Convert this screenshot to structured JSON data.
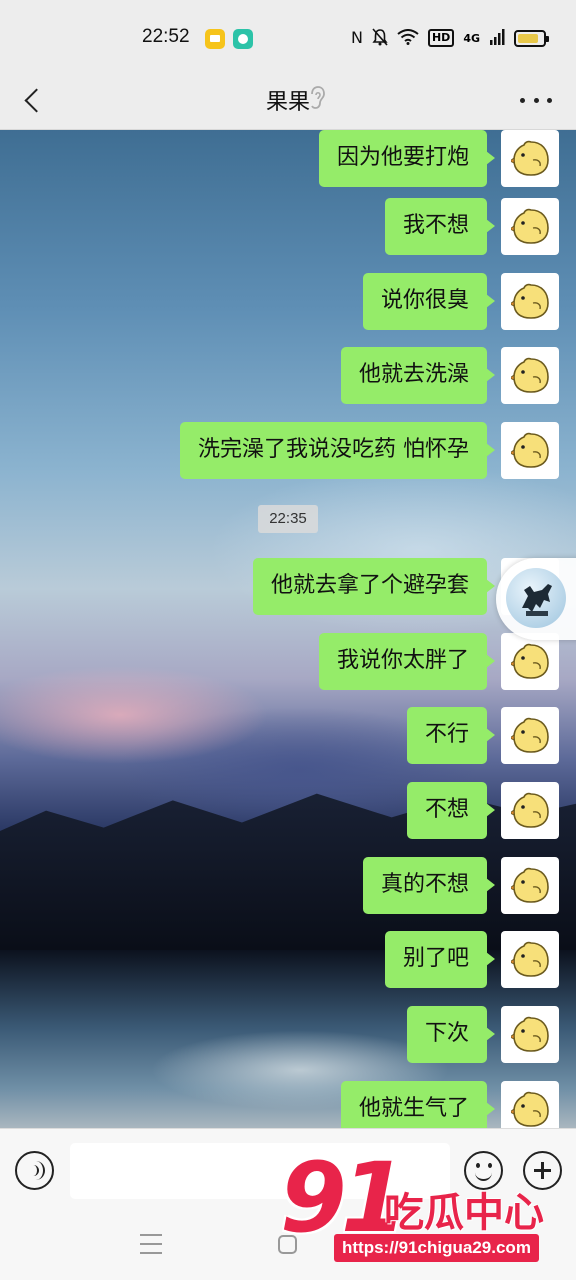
{
  "status_bar": {
    "time": "22:52",
    "network": "4G",
    "hd_label": "HD",
    "battery_level": 0.85
  },
  "header": {
    "title": "果果"
  },
  "messages": [
    {
      "text": "因为他要打炮",
      "sender": "self"
    },
    {
      "text": "我不想",
      "sender": "self"
    },
    {
      "text": "说你很臭",
      "sender": "self"
    },
    {
      "text": "他就去洗澡",
      "sender": "self"
    },
    {
      "text": "洗完澡了我说没吃药 怕怀孕",
      "sender": "self"
    },
    {
      "text": "他就去拿了个避孕套",
      "sender": "self"
    },
    {
      "text": "我说你太胖了",
      "sender": "self"
    },
    {
      "text": "不行",
      "sender": "self"
    },
    {
      "text": "不想",
      "sender": "self"
    },
    {
      "text": "真的不想",
      "sender": "self"
    },
    {
      "text": "别了吧",
      "sender": "self"
    },
    {
      "text": "下次",
      "sender": "self"
    },
    {
      "text": "他就生气了",
      "sender": "self"
    }
  ],
  "time_divider": "22:35",
  "input": {
    "value": "",
    "placeholder": ""
  },
  "watermark": {
    "number": "91",
    "name": "吃瓜中心",
    "url": "https://91chigua29.com"
  },
  "colors": {
    "bubble_self": "#95ec69",
    "watermark": "#e8244a"
  }
}
